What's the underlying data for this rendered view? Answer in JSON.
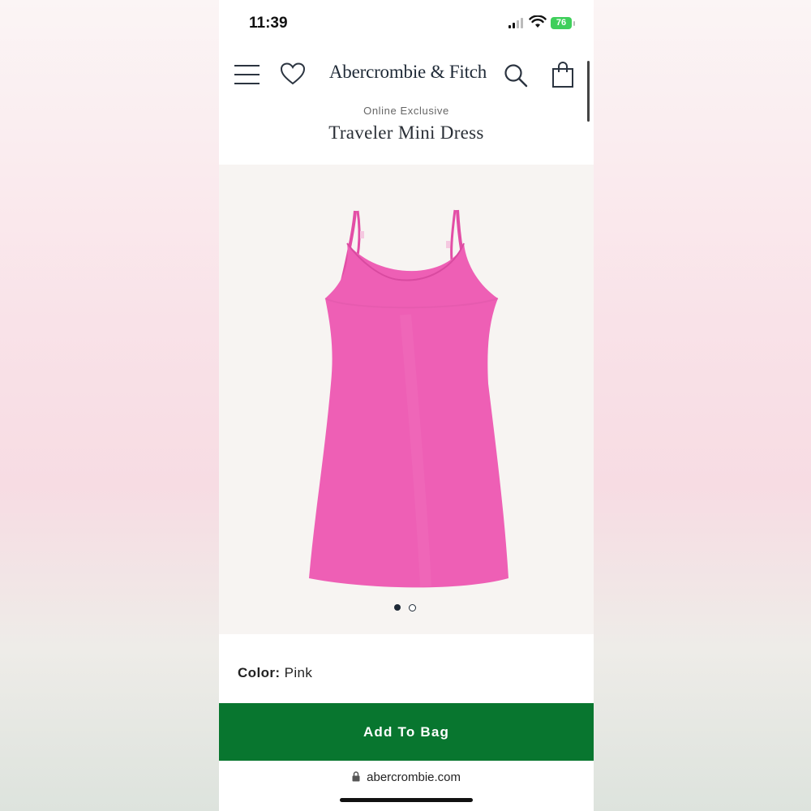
{
  "status_bar": {
    "time": "11:39",
    "battery": "76"
  },
  "header": {
    "brand": "Abercrombie & Fitch",
    "icons": [
      "menu-icon",
      "heart-icon",
      "search-icon",
      "bag-icon"
    ]
  },
  "product": {
    "tagline": "Online Exclusive",
    "title": "Traveler Mini Dress",
    "image_count": 2,
    "image_current": 1,
    "color_label": "Color:",
    "color_value": "Pink",
    "dress_color": "#ee5fb5"
  },
  "actions": {
    "add_to_bag": "Add To Bag"
  },
  "browser": {
    "url": "abercrombie.com"
  },
  "colors": {
    "button_green": "#08762f",
    "brand_navy": "#1f2a37"
  }
}
